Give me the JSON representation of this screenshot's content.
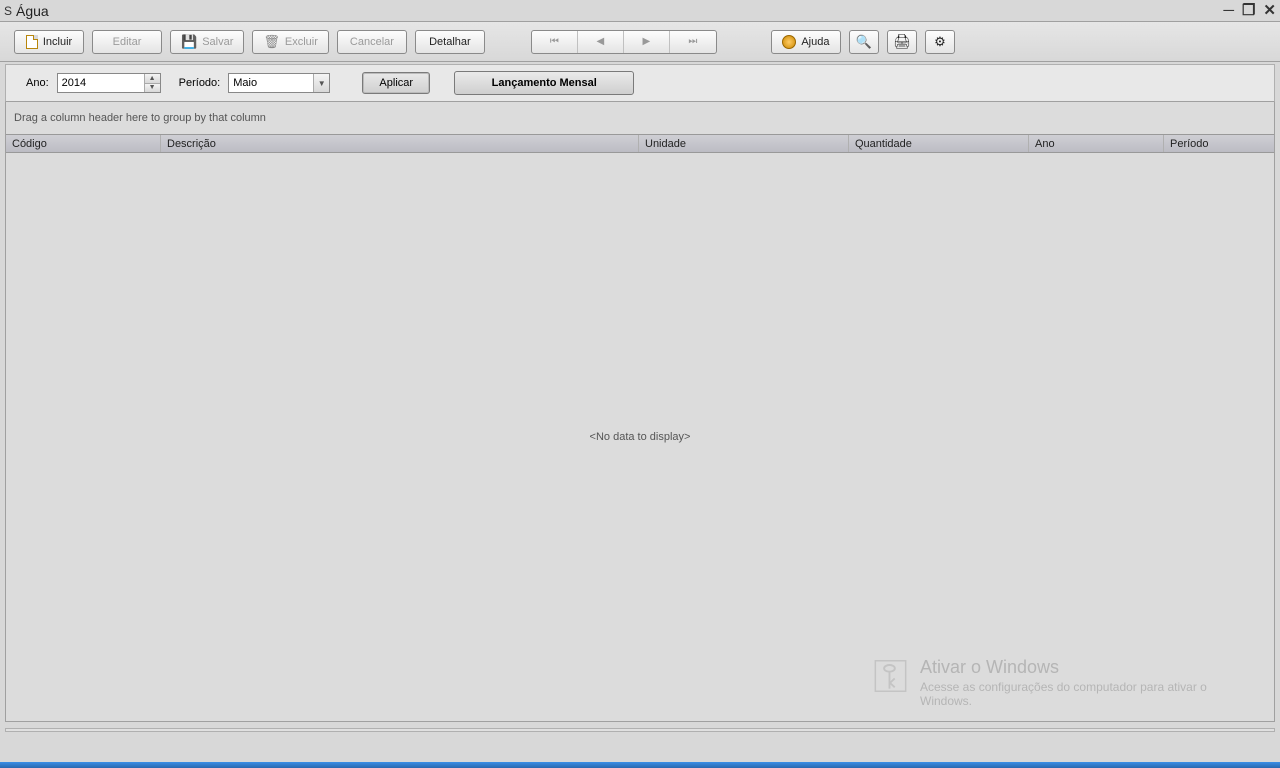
{
  "window": {
    "icon_prefix": "S",
    "title": "Água"
  },
  "toolbar": {
    "incluir": "Incluir",
    "editar": "Editar",
    "salvar": "Salvar",
    "excluir": "Excluir",
    "cancelar": "Cancelar",
    "detalhar": "Detalhar",
    "ajuda": "Ajuda"
  },
  "filter": {
    "ano_label": "Ano:",
    "ano_value": "2014",
    "periodo_label": "Período:",
    "periodo_value": "Maio",
    "aplicar": "Aplicar",
    "lancamento_mensal": "Lançamento Mensal"
  },
  "grid": {
    "group_hint": "Drag a column header here to group by that column",
    "columns": {
      "codigo": "Código",
      "descricao": "Descrição",
      "unidade": "Unidade",
      "quantidade": "Quantidade",
      "ano": "Ano",
      "periodo": "Período"
    },
    "empty": "<No data to display>"
  },
  "watermark": {
    "title": "Ativar o Windows",
    "subtitle": "Acesse as configurações do computador para ativar o Windows."
  }
}
